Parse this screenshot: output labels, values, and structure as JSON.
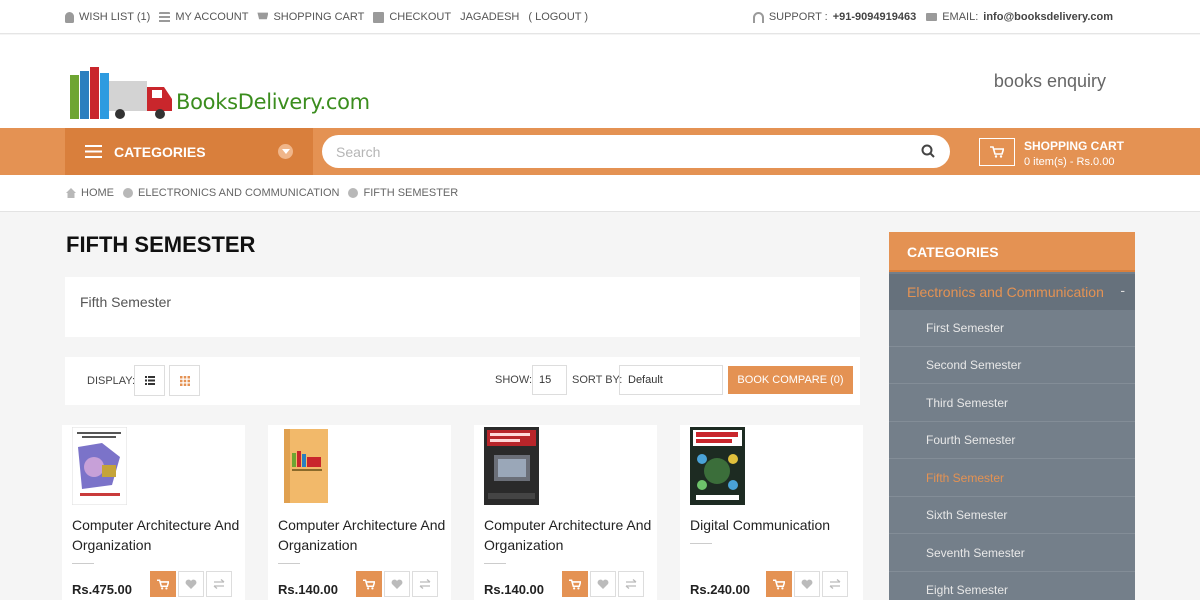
{
  "topbar": {
    "wishlist": "WISH LIST (1)",
    "account": "MY ACCOUNT",
    "cart": "SHOPPING CART",
    "checkout": "CHECKOUT",
    "user": "JAGADESH",
    "logout": "( LOGOUT )",
    "support_label": "SUPPORT :",
    "support_phone": "+91-9094919463",
    "email_label": "EMAIL:",
    "email": "info@booksdelivery.com"
  },
  "header": {
    "logo_text": "BooksDelivery.com",
    "enquiry": "books enquiry"
  },
  "nav": {
    "categories": "CATEGORIES",
    "search_placeholder": "Search",
    "cart_title": "SHOPPING CART",
    "cart_summary": "0 item(s) - Rs.0.00"
  },
  "breadcrumb": [
    "HOME",
    "ELECTRONICS AND COMMUNICATION",
    "FIFTH SEMESTER"
  ],
  "page": {
    "title": "FIFTH SEMESTER",
    "description": "Fifth Semester"
  },
  "toolbar": {
    "display_label": "DISPLAY:",
    "show_label": "SHOW:",
    "show_value": "15",
    "sort_label": "SORT BY:",
    "sort_value": "Default",
    "compare": "BOOK COMPARE (0)"
  },
  "products": [
    {
      "name": "Computer Architecture And Organization",
      "price": "Rs.475.00"
    },
    {
      "name": "Computer Architecture And Organization",
      "price": "Rs.140.00"
    },
    {
      "name": "Computer Architecture And Organization",
      "price": "Rs.140.00"
    },
    {
      "name": "Digital Communication",
      "price": "Rs.240.00"
    }
  ],
  "sidebar": {
    "title": "CATEGORIES",
    "parent": "Electronics and Communication",
    "parent_toggle": "-",
    "items": [
      "First Semester",
      "Second Semester",
      "Third Semester",
      "Fourth Semester",
      "Fifth Semester",
      "Sixth Semester",
      "Seventh Semester",
      "Eight Semester"
    ],
    "active_item": "Fifth Semester"
  },
  "colors": {
    "accent": "#e49253",
    "accent_dark": "#d97f3c",
    "sidebar": "#747f8a"
  }
}
